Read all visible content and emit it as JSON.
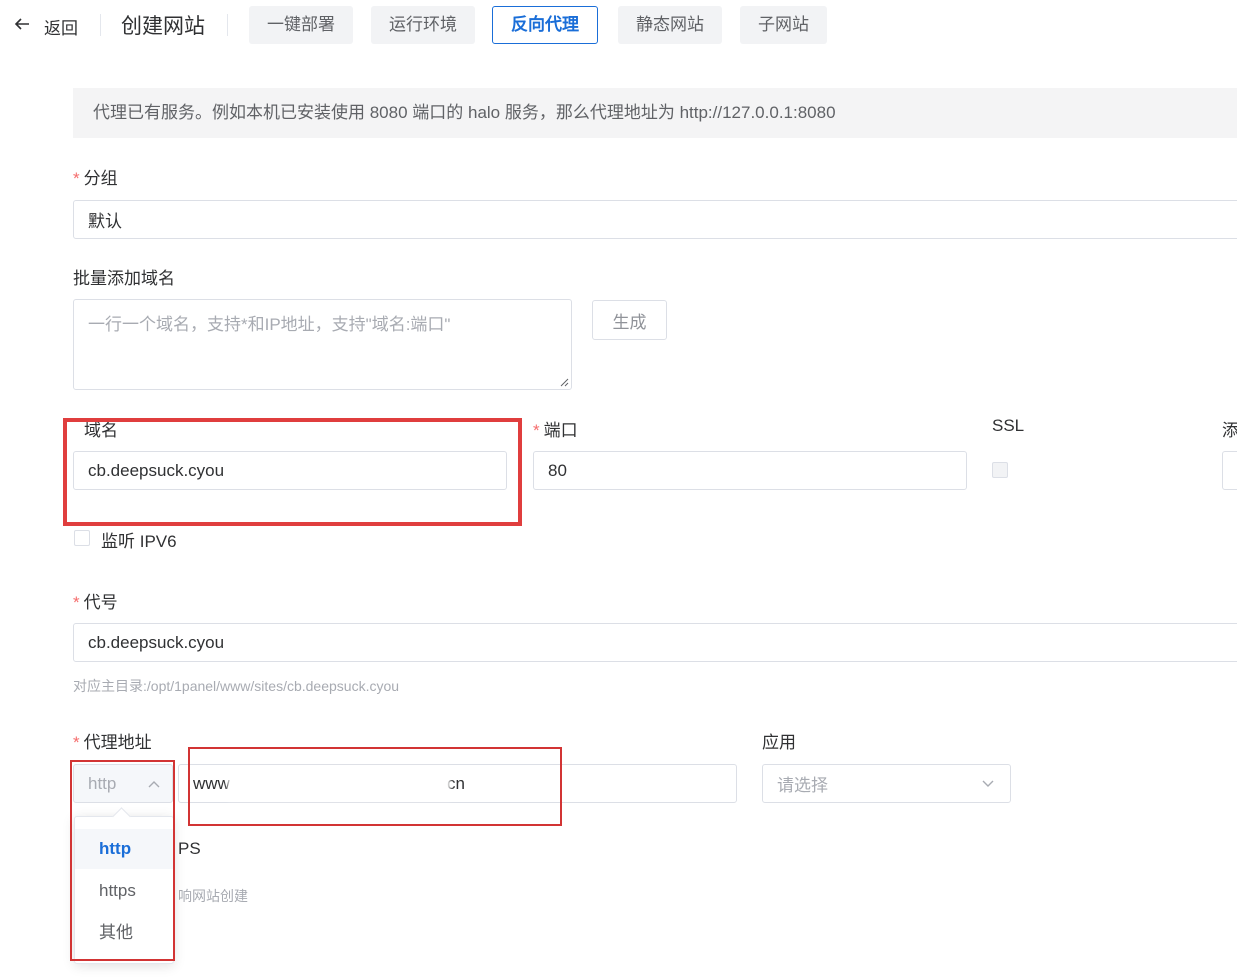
{
  "header": {
    "back_label": "返回",
    "title": "创建网站",
    "tabs": [
      {
        "label": "一键部署",
        "active": false
      },
      {
        "label": "运行环境",
        "active": false
      },
      {
        "label": "反向代理",
        "active": true
      },
      {
        "label": "静态网站",
        "active": false
      },
      {
        "label": "子网站",
        "active": false
      }
    ]
  },
  "info_text": "代理已有服务。例如本机已安装使用 8080 端口的 halo 服务，那么代理地址为 http://127.0.0.1:8080",
  "form": {
    "group": {
      "label": "分组",
      "required_mark": "*",
      "value": "默认"
    },
    "batch_domains": {
      "label": "批量添加域名",
      "placeholder": "一行一个域名，支持*和IP地址，支持\"域名:端口\"",
      "generate_label": "生成"
    },
    "domain": {
      "label": "域名",
      "value": "cb.deepsuck.cyou"
    },
    "port": {
      "label": "端口",
      "required_mark": "*",
      "value": "80"
    },
    "ssl": {
      "label": "SSL"
    },
    "add": {
      "label": "添"
    },
    "ipv6": {
      "label": "监听 IPV6"
    },
    "alias": {
      "label": "代号",
      "required_mark": "*",
      "value": "cb.deepsuck.cyou",
      "hint": "对应主目录:/opt/1panel/www/sites/cb.deepsuck.cyou"
    },
    "proxy": {
      "label": "代理地址",
      "required_mark": "*",
      "scheme": "http",
      "address_prefix": "www",
      "address_suffix": "cn",
      "scheme_options": [
        "http",
        "https",
        "其他"
      ],
      "scheme_selected": "http"
    },
    "app": {
      "label": "应用",
      "placeholder": "请选择"
    },
    "https_partial": "PS",
    "note_partial": "响网站创建"
  },
  "colors": {
    "accent": "#1a6ed8",
    "required": "#f56c6c",
    "highlight": "#e03e3e"
  }
}
